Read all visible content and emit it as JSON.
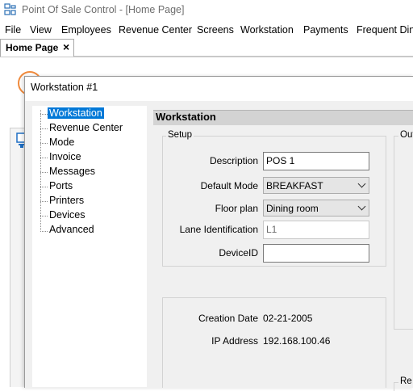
{
  "app": {
    "title": "Point Of Sale Control - [Home Page]"
  },
  "menu": [
    "File",
    "View",
    "Employees",
    "Revenue Center",
    "Screens",
    "Workstation",
    "Payments",
    "Frequent Dine"
  ],
  "tabs": {
    "home": {
      "label": "Home Page",
      "close": "×"
    }
  },
  "dialog": {
    "title": "Workstation #1",
    "tree": [
      "Workstation",
      "Revenue Center",
      "Mode",
      "Invoice",
      "Messages",
      "Ports",
      "Printers",
      "Devices",
      "Advanced"
    ],
    "selected_index": 0,
    "header": "Workstation",
    "setup": {
      "legend": "Setup",
      "description_label": "Description",
      "description_value": "POS 1",
      "default_mode_label": "Default Mode",
      "default_mode_value": "BREAKFAST",
      "floor_plan_label": "Floor plan",
      "floor_plan_value": "Dining room",
      "lane_label": "Lane Identification",
      "lane_value": "L1",
      "device_label": "DeviceID",
      "device_value": ""
    },
    "info": {
      "creation_label": "Creation Date",
      "creation_value": "02-21-2005",
      "ip_label": "IP Address",
      "ip_value": "192.168.100.46"
    },
    "output_legend": "Out",
    "lower_right_legend": "Re"
  }
}
